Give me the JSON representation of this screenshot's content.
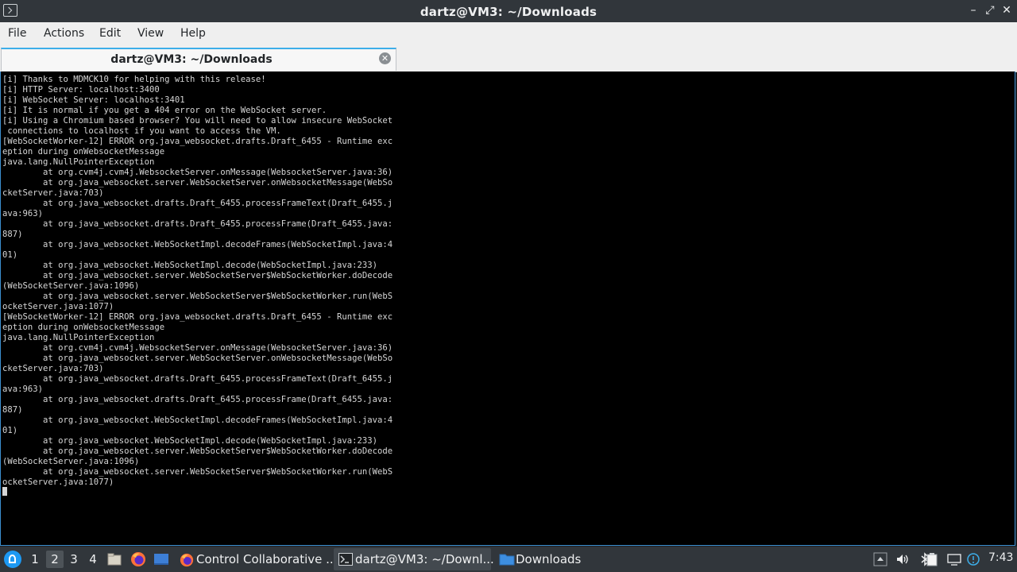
{
  "window": {
    "title": "dartz@VM3: ~/Downloads",
    "controls": {
      "minimize": "–",
      "maximize": "⤢",
      "close": "✕"
    }
  },
  "menu": {
    "file": "File",
    "actions": "Actions",
    "edit": "Edit",
    "view": "View",
    "help": "Help"
  },
  "tab": {
    "label": "dartz@VM3: ~/Downloads",
    "close": "✕"
  },
  "terminal": {
    "output": "[i] Thanks to MDMCK10 for helping with this release!\n[i] HTTP Server: localhost:3400\n[i] WebSocket Server: localhost:3401\n[i] It is normal if you get a 404 error on the WebSocket server.\n[i] Using a Chromium based browser? You will need to allow insecure WebSocket\n connections to localhost if you want to access the VM.\n[WebSocketWorker-12] ERROR org.java_websocket.drafts.Draft_6455 - Runtime exc\neption during onWebsocketMessage\njava.lang.NullPointerException\n        at org.cvm4j.cvm4j.WebsocketServer.onMessage(WebsocketServer.java:36)\n        at org.java_websocket.server.WebSocketServer.onWebsocketMessage(WebSo\ncketServer.java:703)\n        at org.java_websocket.drafts.Draft_6455.processFrameText(Draft_6455.j\nava:963)\n        at org.java_websocket.drafts.Draft_6455.processFrame(Draft_6455.java:\n887)\n        at org.java_websocket.WebSocketImpl.decodeFrames(WebSocketImpl.java:4\n01)\n        at org.java_websocket.WebSocketImpl.decode(WebSocketImpl.java:233)\n        at org.java_websocket.server.WebSocketServer$WebSocketWorker.doDecode\n(WebSocketServer.java:1096)\n        at org.java_websocket.server.WebSocketServer$WebSocketWorker.run(WebS\nocketServer.java:1077)\n[WebSocketWorker-12] ERROR org.java_websocket.drafts.Draft_6455 - Runtime exc\neption during onWebsocketMessage\njava.lang.NullPointerException\n        at org.cvm4j.cvm4j.WebsocketServer.onMessage(WebsocketServer.java:36)\n        at org.java_websocket.server.WebSocketServer.onWebsocketMessage(WebSo\ncketServer.java:703)\n        at org.java_websocket.drafts.Draft_6455.processFrameText(Draft_6455.j\nava:963)\n        at org.java_websocket.drafts.Draft_6455.processFrame(Draft_6455.java:\n887)\n        at org.java_websocket.WebSocketImpl.decodeFrames(WebSocketImpl.java:4\n01)\n        at org.java_websocket.WebSocketImpl.decode(WebSocketImpl.java:233)\n        at org.java_websocket.server.WebSocketServer$WebSocketWorker.doDecode\n(WebSocketServer.java:1096)\n        at org.java_websocket.server.WebSocketServer$WebSocketWorker.run(WebS\nocketServer.java:1077)"
  },
  "taskbar": {
    "desktops": [
      "1",
      "2",
      "3",
      "4"
    ],
    "active_desktop": "2",
    "launchers": [
      "file-manager-icon",
      "firefox-icon",
      "show-desktop-icon"
    ],
    "tasks": [
      {
        "label": "Control Collaborative ...",
        "icon": "firefox-icon",
        "active": false
      },
      {
        "label": "dartz@VM3: ~/Downl...",
        "icon": "terminal-icon",
        "active": true
      },
      {
        "label": "Downloads",
        "icon": "folder-icon",
        "active": false
      }
    ],
    "tray": [
      "tray-arrow-icon",
      "volume-icon",
      "bluetooth-icon",
      "clipboard-icon",
      "display-icon",
      "network-icon"
    ],
    "clock": "7:43"
  },
  "colors": {
    "titlebar_bg": "#31363b",
    "menubar_bg": "#efefef",
    "terminal_bg": "#000000",
    "terminal_fg": "#d6d6d6",
    "accent": "#3daee9",
    "taskbar_bg": "#31363b"
  }
}
